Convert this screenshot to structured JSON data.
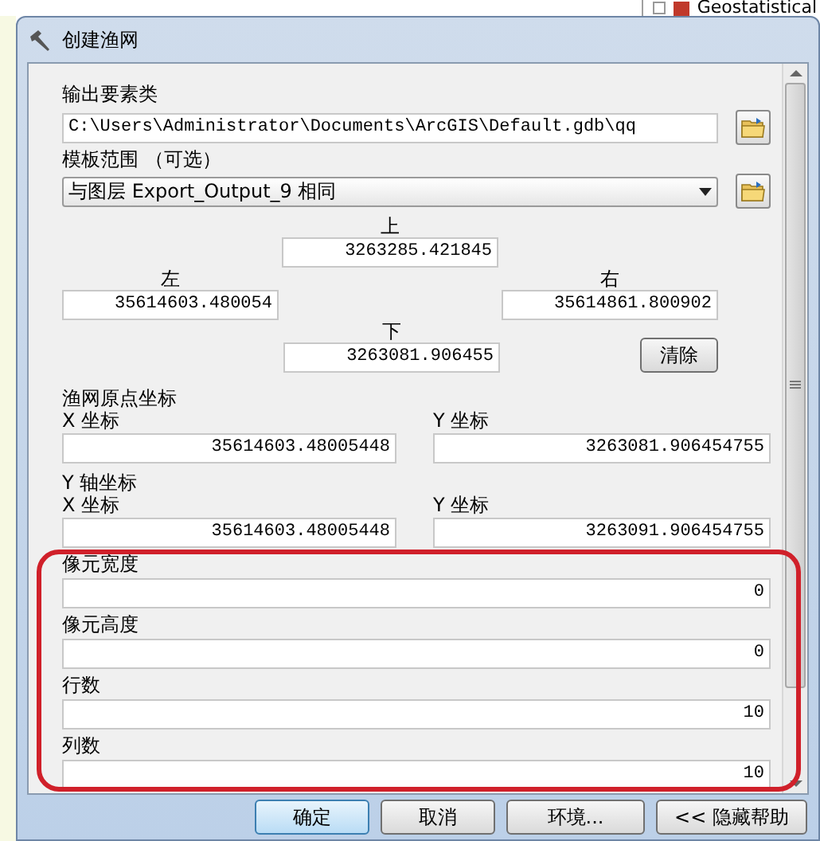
{
  "background": {
    "tree_item": "Geostatistical"
  },
  "window": {
    "title": "创建渔网"
  },
  "output_feature_class": {
    "label": "输出要素类",
    "value": "C:\\Users\\Administrator\\Documents\\ArcGIS\\Default.gdb\\qq"
  },
  "template_extent": {
    "label": "模板范围 （可选）",
    "value": "与图层 Export_Output_9 相同",
    "top": {
      "label": "上",
      "value": "3263285.421845"
    },
    "left": {
      "label": "左",
      "value": "35614603.480054"
    },
    "right": {
      "label": "右",
      "value": "35614861.800902"
    },
    "bottom": {
      "label": "下",
      "value": "3263081.906455"
    },
    "clear_button": "清除"
  },
  "origin": {
    "label": "渔网原点坐标",
    "x": {
      "label": "X 坐标",
      "value": "35614603.48005448"
    },
    "y": {
      "label": "Y 坐标",
      "value": "3263081.906454755"
    }
  },
  "y_axis": {
    "label": "Y 轴坐标",
    "x": {
      "label": "X 坐标",
      "value": "35614603.48005448"
    },
    "y": {
      "label": "Y 坐标",
      "value": "3263091.906454755"
    }
  },
  "fields": [
    {
      "label": "像元宽度",
      "value": "0"
    },
    {
      "label": "像元高度",
      "value": "0"
    },
    {
      "label": "行数",
      "value": "10"
    },
    {
      "label": "列数",
      "value": "10"
    }
  ],
  "buttons": [
    {
      "label": "确定",
      "default": true
    },
    {
      "label": "取消",
      "default": false
    },
    {
      "label": "环境...",
      "default": false
    },
    {
      "label": "<< 隐藏帮助",
      "default": false
    }
  ]
}
